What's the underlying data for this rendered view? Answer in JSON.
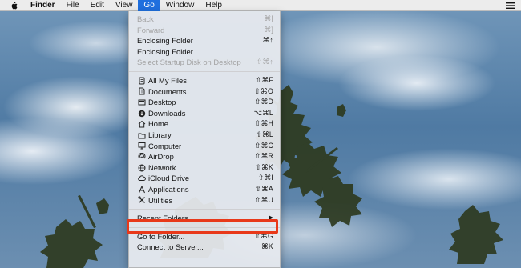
{
  "menubar": {
    "apple_icon": "apple-icon",
    "items": [
      {
        "label": "Finder",
        "bold": true,
        "active": false
      },
      {
        "label": "File",
        "active": false
      },
      {
        "label": "Edit",
        "active": false
      },
      {
        "label": "View",
        "active": false
      },
      {
        "label": "Go",
        "active": true
      },
      {
        "label": "Window",
        "active": false
      },
      {
        "label": "Help",
        "active": false
      }
    ],
    "right_icon": "menu-extras-icon"
  },
  "go_menu": {
    "group1": [
      {
        "label": "Back",
        "shortcut": "⌘[",
        "disabled": true
      },
      {
        "label": "Forward",
        "shortcut": "⌘]",
        "disabled": true
      },
      {
        "label": "Enclosing Folder",
        "shortcut": "⌘↑",
        "disabled": false
      },
      {
        "label": "Enclosing Folder",
        "shortcut": "",
        "disabled": false
      },
      {
        "label": "Select Startup Disk on Desktop",
        "shortcut": "⇧⌘↑",
        "disabled": true
      }
    ],
    "group2": [
      {
        "label": "All My Files",
        "shortcut": "⇧⌘F",
        "icon": "all-files-icon"
      },
      {
        "label": "Documents",
        "shortcut": "⇧⌘O",
        "icon": "documents-icon"
      },
      {
        "label": "Desktop",
        "shortcut": "⇧⌘D",
        "icon": "desktop-icon"
      },
      {
        "label": "Downloads",
        "shortcut": "⌥⌘L",
        "icon": "downloads-icon"
      },
      {
        "label": "Home",
        "shortcut": "⇧⌘H",
        "icon": "home-icon"
      },
      {
        "label": "Library",
        "shortcut": "⇧⌘L",
        "icon": "library-icon"
      },
      {
        "label": "Computer",
        "shortcut": "⇧⌘C",
        "icon": "computer-icon"
      },
      {
        "label": "AirDrop",
        "shortcut": "⇧⌘R",
        "icon": "airdrop-icon"
      },
      {
        "label": "Network",
        "shortcut": "⇧⌘K",
        "icon": "network-icon"
      },
      {
        "label": "iCloud Drive",
        "shortcut": "⇧⌘I",
        "icon": "icloud-icon"
      },
      {
        "label": "Applications",
        "shortcut": "⇧⌘A",
        "icon": "applications-icon"
      },
      {
        "label": "Utilities",
        "shortcut": "⇧⌘U",
        "icon": "utilities-icon"
      }
    ],
    "recent_folders": {
      "label": "Recent Folders",
      "arrow": "▶"
    },
    "go_to_folder": {
      "label": "Go to Folder...",
      "shortcut": "⇧⌘G"
    },
    "connect_to_server": {
      "label": "Connect to Server...",
      "shortcut": "⌘K"
    },
    "highlight_color": "#e8391a",
    "active_menu_color": "#1f6fde"
  }
}
